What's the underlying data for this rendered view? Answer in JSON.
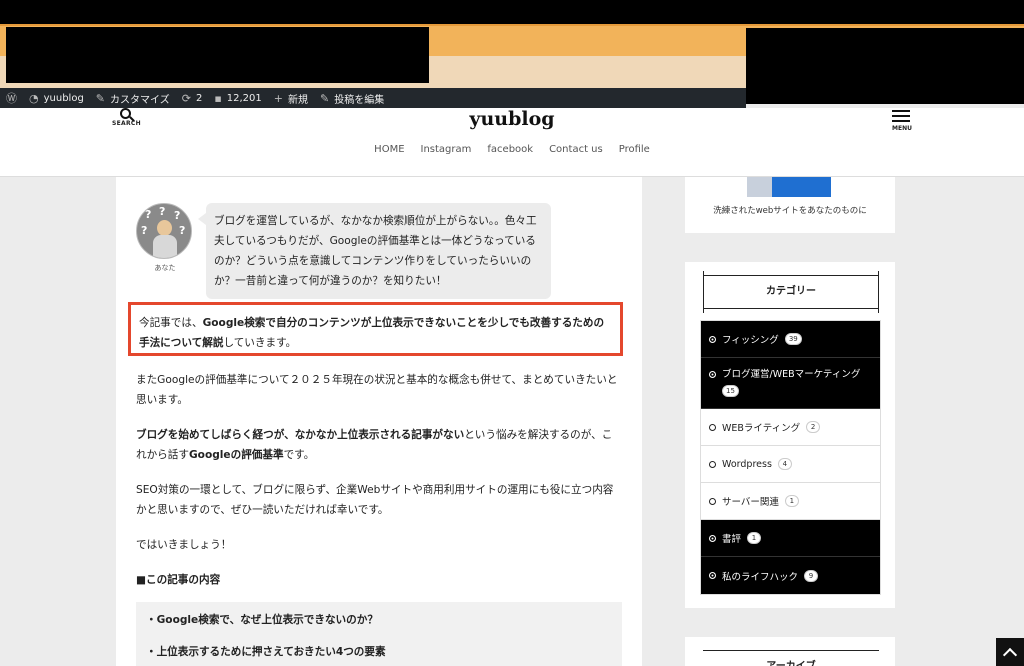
{
  "adminbar": {
    "site": "yuublog",
    "customize": "カスタマイズ",
    "updates": "2",
    "comments": "12,201",
    "new": "新規",
    "edit": "投稿を編集"
  },
  "header": {
    "search_label": "SEARCH",
    "title": "yuublog",
    "menu_label": "MENU",
    "nav": [
      "HOME",
      "Instagram",
      "facebook",
      "Contact us",
      "Profile"
    ]
  },
  "article": {
    "avatar_name": "あなた",
    "bubble": "ブログを運営しているが、なかなか検索順位が上がらない。。色々工夫しているつもりだが、Googleの評価基準とは一体どうなっているのか？どういう点を意識してコンテンツ作りをしていったらいいのか？一昔前と違って何が違うのか？を知りたい！",
    "highlight_pre": "今記事では、",
    "highlight_bold": "Google検索で自分のコンテンツが上位表示できないことを少しでも改善するための手法について解説",
    "highlight_post": "していきます。",
    "p1": "またGoogleの評価基準について２０２５年現在の状況と基本的な概念も併せて、まとめていきたいと思います。",
    "p2_bold1": "ブログを始めてしばらく経つが、なかなか上位表示される記事がない",
    "p2_mid": "という悩みを解決するのが、これから話す",
    "p2_bold2": "Googleの評価基準",
    "p2_end": "です。",
    "p3": "SEO対策の一環として、ブログに限らず、企業Webサイトや商用利用サイトの運用にも役に立つ内容かと思いますので、ぜひ一読いただければ幸いです。",
    "p4": "ではいきましょう！",
    "toc_title": "■この記事の内容",
    "toc": [
      "・Google検索で、なぜ上位表示できないのか？",
      "・上位表示するために押さえておきたい4つの要素"
    ]
  },
  "sidebar": {
    "promo_caption": "洗練されたwebサイトをあなたのものに",
    "categories_title": "カテゴリー",
    "categories": [
      {
        "name": "フィッシング",
        "count": "39",
        "dark": true
      },
      {
        "name": "ブログ運営/WEBマーケティング",
        "count": "15",
        "dark": true
      },
      {
        "name": "WEBライティング",
        "count": "2",
        "dark": false
      },
      {
        "name": "Wordpress",
        "count": "4",
        "dark": false
      },
      {
        "name": "サーバー関連",
        "count": "1",
        "dark": false
      },
      {
        "name": "書評",
        "count": "1",
        "dark": true
      },
      {
        "name": "私のライフハック",
        "count": "9",
        "dark": true
      }
    ],
    "archive_title": "アーカイブ"
  },
  "colors": {
    "accent": "#e4472d",
    "admin_bar": "#23282d",
    "banner": "#f2b35a"
  }
}
